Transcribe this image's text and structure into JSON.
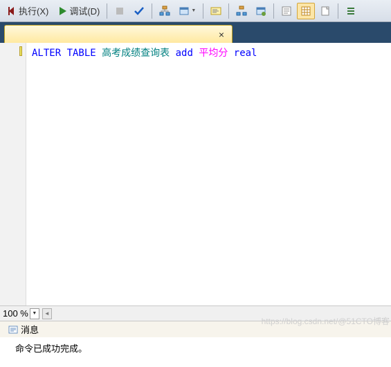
{
  "toolbar": {
    "execute_label": "执行(X)",
    "debug_label": "调试(D)"
  },
  "tab": {
    "title": ""
  },
  "sql": {
    "kw_alter_table": "ALTER TABLE",
    "table_name": "高考成绩查询表",
    "kw_add": "add",
    "column_name": "平均分",
    "datatype": "real"
  },
  "zoom": {
    "value": "100 %"
  },
  "messages": {
    "tab_label": "消息",
    "body": "命令已成功完成。"
  },
  "watermark": "https://blog.csdn.net/@51CTO博客"
}
